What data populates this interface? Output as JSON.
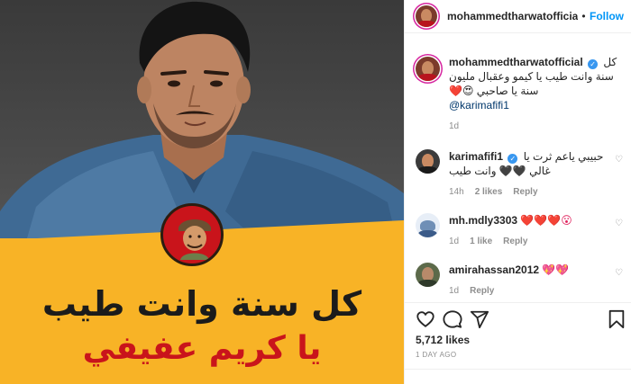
{
  "post": {
    "headline_line1": "كل سنة وانت طيب",
    "headline_line2": "يا كريم عفيفي"
  },
  "header": {
    "username": "mohammedtharwatofficia",
    "separator": "•",
    "follow_label": "Follow"
  },
  "caption": {
    "username": "mohammedtharwatofficial",
    "text": "كل سنة وانت طيب يا كيمو وعقبال مليون سنة يا صاحبي 😍❤️",
    "mention": "@karimafifi1",
    "age": "1d"
  },
  "comments": [
    {
      "username": "karimafifi1",
      "verified": true,
      "text": "حبيبي ياعم ثرت يا غالي 🖤🖤 وانت طيب",
      "age": "14h",
      "likes": "2 likes",
      "reply": "Reply"
    },
    {
      "username": "mh.mdly3303",
      "verified": false,
      "text": "❤️❤️❤️😮",
      "age": "1d",
      "likes": "1 like",
      "reply": "Reply"
    },
    {
      "username": "amirahassan2012",
      "verified": false,
      "text": "💖💖",
      "age": "1d",
      "likes": "",
      "reply": "Reply"
    }
  ],
  "footer": {
    "likes": "5,712 likes",
    "time": "1 DAY AGO"
  },
  "icons": {
    "like": "heart-outline-icon",
    "comment": "speech-bubble-icon",
    "share": "paper-plane-icon",
    "save": "bookmark-icon"
  },
  "colors": {
    "accent": "#0095f6",
    "verified": "#3897f0",
    "banner": "#f8b326",
    "title_red": "#c9141b"
  }
}
